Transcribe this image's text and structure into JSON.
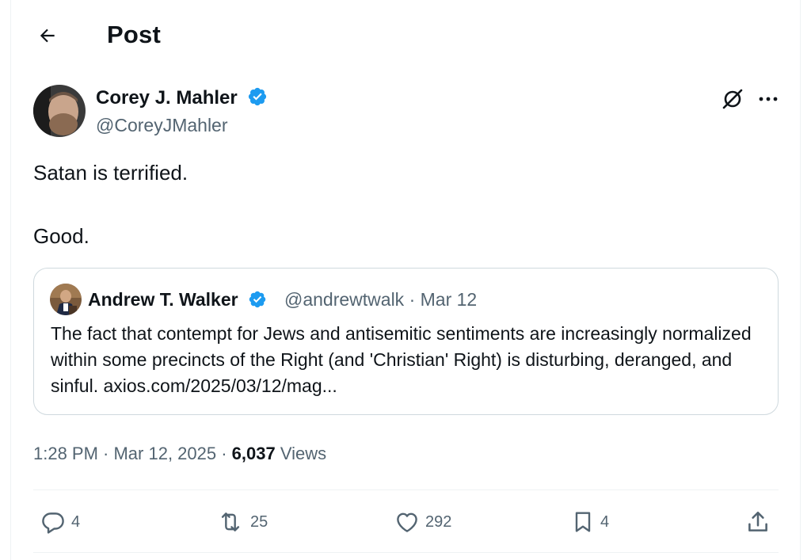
{
  "header": {
    "title": "Post",
    "back_icon": "arrow-left-icon"
  },
  "post": {
    "author_name": "Corey J. Mahler",
    "author_handle": "@CoreyJMahler",
    "verified_icon": "verified-badge-icon",
    "text_lines": [
      "Satan is terrified.",
      "",
      "Good."
    ],
    "timestamp": "1:28 PM · Mar 12, 2025 · ",
    "views_count": "6,037",
    "views_label": " Views"
  },
  "quote": {
    "author_name": "Andrew T. Walker",
    "author_handle_date": "@andrewtwalk · Mar 12",
    "text": "The fact that contempt for Jews and antisemitic sentiments are increasingly normalized within some precincts of the Right (and 'Christian' Right) is disturbing, deranged, and sinful. axios.com/2025/03/12/mag..."
  },
  "actions": {
    "replies": "4",
    "reposts": "25",
    "likes": "292",
    "bookmarks": "4"
  },
  "colors": {
    "verified": "#1d9bf0",
    "secondary_text": "#536471",
    "primary_text": "#0f1419",
    "border": "#cfd9de"
  }
}
